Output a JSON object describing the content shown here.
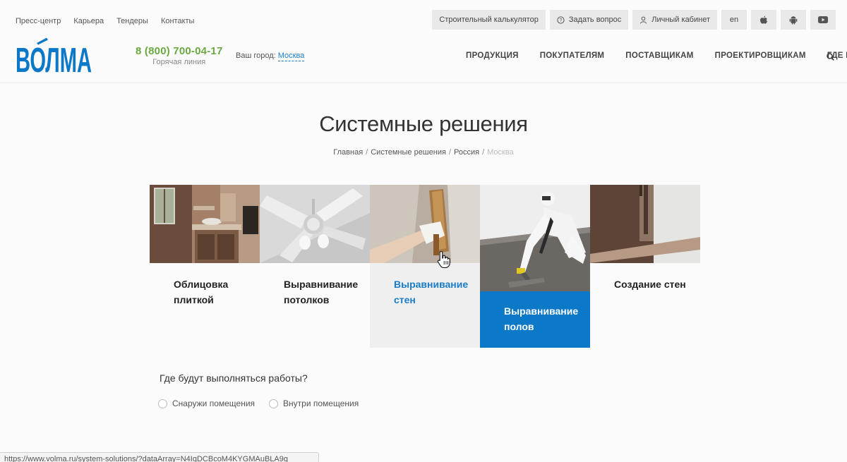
{
  "top_links": [
    "Пресс-центр",
    "Карьера",
    "Тендеры",
    "Контакты"
  ],
  "top_buttons": {
    "calculator": "Строительный калькулятор",
    "ask": "Задать вопрос",
    "cabinet": "Личный кабинет",
    "lang": "en"
  },
  "brand": {
    "logo_text": "ВОЛМА",
    "color": "#0b78c8"
  },
  "phone": {
    "number": "8 (800) 700-04-17",
    "caption": "Горячая линия",
    "color": "#6aa842"
  },
  "city": {
    "label": "Ваш город:",
    "value": "Москва"
  },
  "nav": [
    "ПРОДУКЦИЯ",
    "ПОКУПАТЕЛЯМ",
    "ПОСТАВЩИКАМ",
    "ПРОЕКТИРОВЩИКАМ",
    "ГДЕ КУПИТЬ"
  ],
  "page_title": "Системные решения",
  "breadcrumbs": [
    "Главная",
    "Системные решения",
    "Россия",
    "Москва"
  ],
  "tiles": [
    {
      "label": "Облицовка плиткой",
      "state": "default"
    },
    {
      "label": "Выравнивание потолков",
      "state": "default"
    },
    {
      "label": "Выравнивание стен",
      "state": "hover"
    },
    {
      "label": "Выравнивание полов",
      "state": "active"
    },
    {
      "label": "Создание стен",
      "state": "default"
    }
  ],
  "question": {
    "text": "Где будут выполняться работы?",
    "options": [
      "Снаружи помещения",
      "Внутри помещения"
    ]
  },
  "status_url": "https://www.volma.ru/system-solutions/?dataArray=N4IgDCBcoM4KYGMAuBLA9g"
}
